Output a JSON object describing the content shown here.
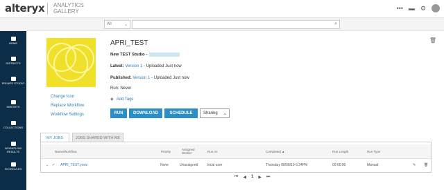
{
  "header": {
    "logo": "alteryx",
    "gallery_line1": "ANALYTICS",
    "gallery_line2": "GALLERY",
    "icons": [
      "more-icon",
      "message-icon",
      "gear-icon",
      "avatar"
    ]
  },
  "search": {
    "filter_value": "All",
    "placeholder": ""
  },
  "sidebar": {
    "items": [
      {
        "label": "HOME",
        "icon": "home-icon"
      },
      {
        "label": "DISTRICTS",
        "icon": "districts-icon"
      },
      {
        "label": "PRIVATE STUDIO",
        "icon": "private-studio-icon"
      },
      {
        "label": "INSIGHTS",
        "icon": "insights-icon"
      },
      {
        "label": "COLLECTIONS",
        "icon": "collections-icon"
      },
      {
        "label": "WORKFLOW RESULTS",
        "icon": "workflow-results-icon"
      },
      {
        "label": "SCHEDULES",
        "icon": "schedules-icon"
      }
    ]
  },
  "workflow": {
    "title": "APRI_TEST",
    "studio_label": "New TEST Studio -",
    "latest_label": "Latest:",
    "latest_version": "Version 1",
    "latest_suffix": "- Uploaded Just now",
    "published_label": "Published:",
    "published_version": "Version 1",
    "published_suffix": "- Uploaded Just now",
    "run_status": "Run: Never",
    "add_tags": "Add Tags"
  },
  "side_links": {
    "change_icon": "Change Icon",
    "replace_workflow": "Replace Workflow",
    "workflow_settings": "Workflow Settings"
  },
  "actions": {
    "run": "RUN",
    "download": "DOWNLOAD",
    "schedule": "SCHEDULE",
    "sharing": "Sharing"
  },
  "tabs": {
    "my_jobs": "MY JOBS",
    "shared_jobs": "JOBS SHARED WITH ME"
  },
  "jobs_table": {
    "columns": [
      "Name/Workflow",
      "Priority",
      "Assigned Worker",
      "Run As",
      "Completed ▲",
      "Run Length",
      "Run Type"
    ],
    "rows": [
      {
        "name": "APRI_TEST.yxwz",
        "priority": "None",
        "worker": "Unassigned",
        "run_as": "local user",
        "completed": "Thursday 08/08/19 6:34PM",
        "run_length": "00:00:00",
        "run_type": "Manual"
      }
    ]
  },
  "pager": {
    "current": "1"
  },
  "colors": {
    "accent": "#2b8ec6",
    "sidebar": "#0b2d47",
    "thumbnail": "#f0e02a"
  }
}
